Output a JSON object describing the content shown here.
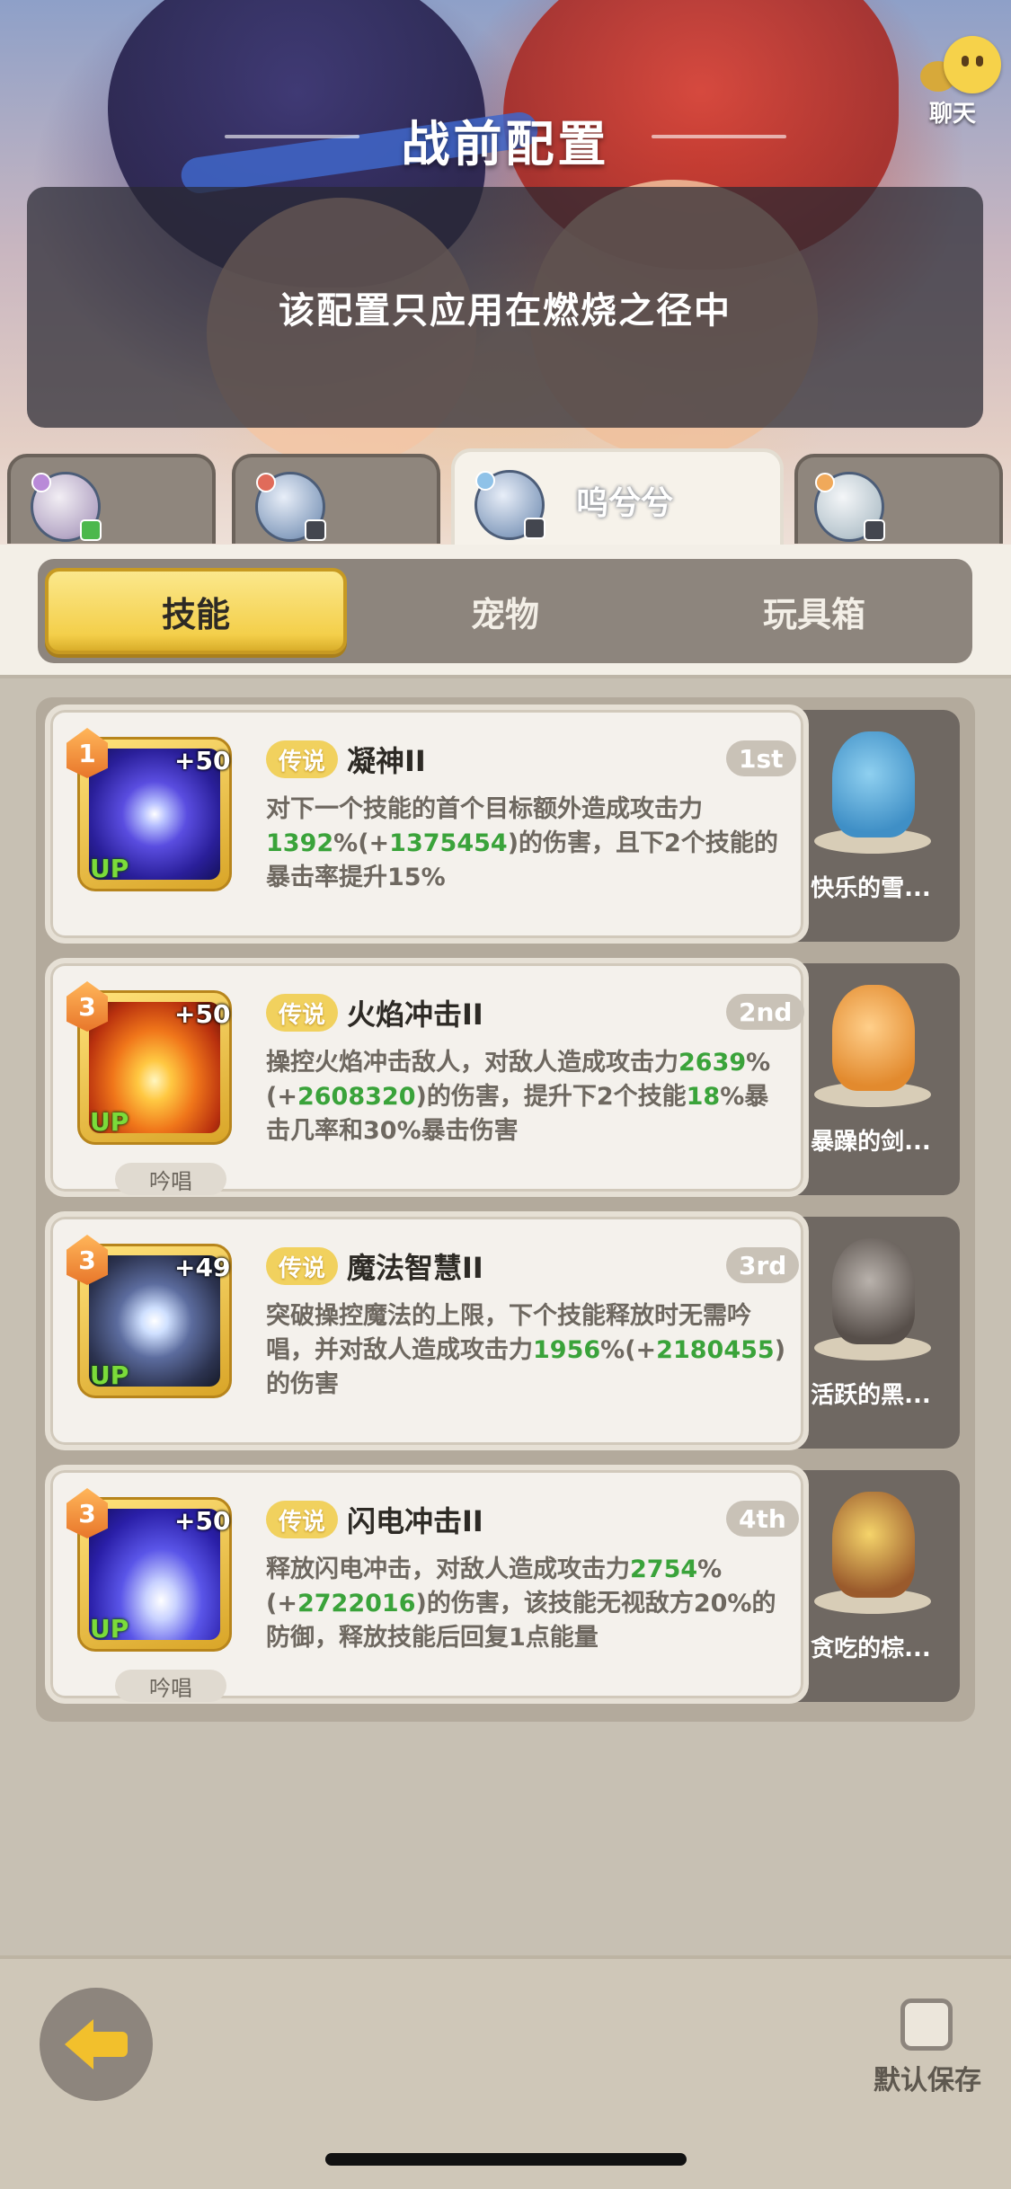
{
  "header": {
    "title": "战前配置",
    "chat_label": "聊天",
    "notice": "该配置只应用在燃烧之径中"
  },
  "characters": [
    {
      "name": "",
      "active": false
    },
    {
      "name": "",
      "active": false
    },
    {
      "name": "呜兮兮",
      "active": true
    },
    {
      "name": "",
      "active": false
    }
  ],
  "segments": {
    "skill": "技能",
    "pet": "宠物",
    "toybox": "玩具箱"
  },
  "skills": [
    {
      "level": "1",
      "plus": "+50",
      "up": "UP",
      "chant": "",
      "rarity": "传说",
      "name": "凝神II",
      "rank": "1st",
      "desc_parts": [
        {
          "t": "对下一个技能的首个目标额外造成攻击力",
          "g": false
        },
        {
          "t": "1392",
          "g": true
        },
        {
          "t": "%(+",
          "g": false
        },
        {
          "t": "1375454",
          "g": true
        },
        {
          "t": ")的伤害，且下2个技能的暴击率提升15%",
          "g": false
        }
      ],
      "pet": "快乐的雪..."
    },
    {
      "level": "3",
      "plus": "+50",
      "up": "UP",
      "chant": "吟唱",
      "rarity": "传说",
      "name": "火焰冲击II",
      "rank": "2nd",
      "desc_parts": [
        {
          "t": "操控火焰冲击敌人，对敌人造成攻击力",
          "g": false
        },
        {
          "t": "2639",
          "g": true
        },
        {
          "t": "%(+",
          "g": false
        },
        {
          "t": "2608320",
          "g": true
        },
        {
          "t": ")的伤害，提升下2个技能",
          "g": false
        },
        {
          "t": "18",
          "g": true
        },
        {
          "t": "%暴击几率和30%暴击伤害",
          "g": false
        }
      ],
      "pet": "暴躁的剑..."
    },
    {
      "level": "3",
      "plus": "+49",
      "up": "UP",
      "chant": "",
      "rarity": "传说",
      "name": "魔法智慧II",
      "rank": "3rd",
      "desc_parts": [
        {
          "t": "突破操控魔法的上限，下个技能释放时无需吟唱，并对敌人造成攻击力",
          "g": false
        },
        {
          "t": "1956",
          "g": true
        },
        {
          "t": "%(+",
          "g": false
        },
        {
          "t": "2180455",
          "g": true
        },
        {
          "t": ")的伤害",
          "g": false
        }
      ],
      "pet": "活跃的黑..."
    },
    {
      "level": "3",
      "plus": "+50",
      "up": "UP",
      "chant": "吟唱",
      "rarity": "传说",
      "name": "闪电冲击II",
      "rank": "4th",
      "desc_parts": [
        {
          "t": "释放闪电冲击，对敌人造成攻击力",
          "g": false
        },
        {
          "t": "2754",
          "g": true
        },
        {
          "t": "%(+",
          "g": false
        },
        {
          "t": "2722016",
          "g": true
        },
        {
          "t": ")的伤害，该技能无视敌方20%的防御，释放技能后回复1点能量",
          "g": false
        }
      ],
      "pet": "贪吃的棕..."
    }
  ],
  "footer": {
    "default_save": "默认保存"
  },
  "colors": {
    "accent_yellow": "#f4cf4a",
    "highlight_green": "#3aa33a"
  }
}
